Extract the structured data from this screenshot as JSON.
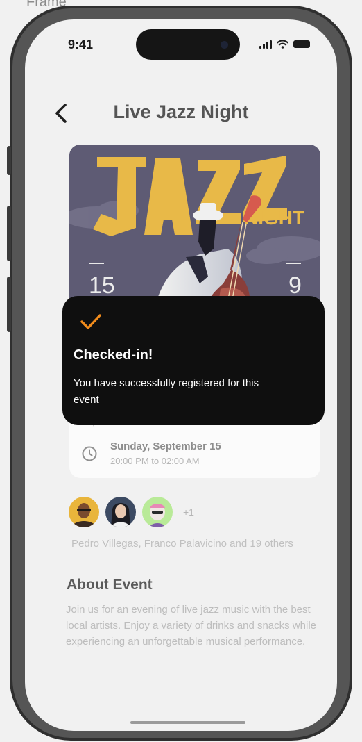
{
  "frame": {
    "label": "Frame"
  },
  "status_bar": {
    "time": "9:41"
  },
  "header": {
    "title": "Live Jazz Night"
  },
  "poster": {
    "headline": "JAZZ",
    "sub": "NIGHT",
    "left_number": "15",
    "right_number": "9"
  },
  "event": {
    "date": "Sunday, September 15",
    "time": "20:00 PM to 02:00 AM"
  },
  "toast": {
    "title": "Checked-in!",
    "message": "You have successfully registered for this event"
  },
  "attendees": {
    "extra_count": "+1",
    "summary": "Pedro Villegas, Franco Palavicino and 19 others"
  },
  "about": {
    "title": "About Event",
    "text": "Join us for an evening of live jazz music with the best local artists. Enjoy a variety of drinks and snacks while experiencing an unforgettable musical performance."
  },
  "colors": {
    "accent": "#f28c1c",
    "toast_bg": "#0f0f0f",
    "poster_bg": "#5e5b74",
    "poster_yellow": "#e8b948"
  },
  "icons": [
    "back-chevron-icon",
    "check-icon",
    "location-pin-icon",
    "clock-icon",
    "signal-icon",
    "wifi-icon",
    "battery-icon"
  ]
}
